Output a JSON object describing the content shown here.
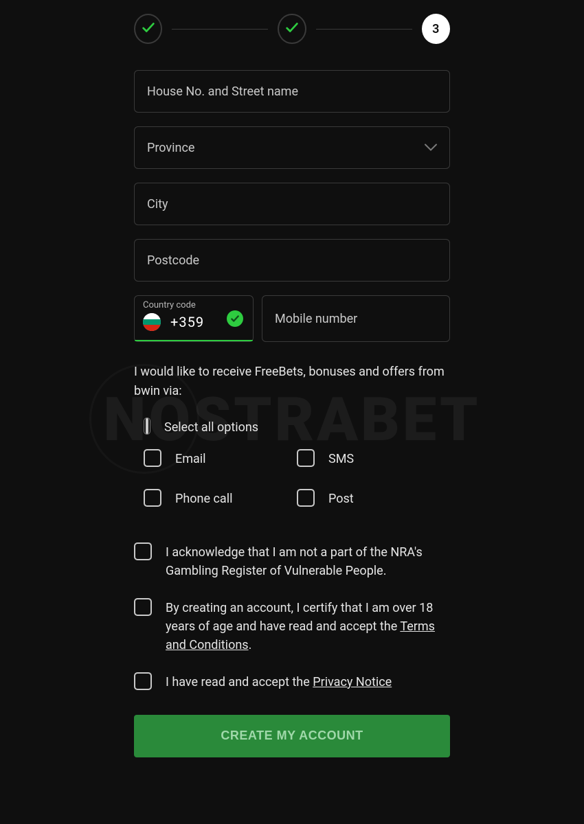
{
  "stepper": {
    "step1_state": "done",
    "step2_state": "done",
    "step3_label": "3"
  },
  "fields": {
    "street_placeholder": "House No. and Street name",
    "province_placeholder": "Province",
    "city_placeholder": "City",
    "postcode_placeholder": "Postcode",
    "country_code_label": "Country code",
    "country_code_value": "+359",
    "mobile_placeholder": "Mobile number"
  },
  "marketing": {
    "intro": "I would like to receive FreeBets, bonuses and offers from bwin via:",
    "select_all": "Select all options",
    "options": {
      "email": "Email",
      "sms": "SMS",
      "phone": "Phone call",
      "post": "Post"
    }
  },
  "consents": {
    "nra": "I acknowledge that I am not a part of the NRA's Gambling Register of Vulnerable People.",
    "terms_pre": "By creating an account, I certify that I am over 18 years of age and have read and accept the ",
    "terms_link": "Terms and Conditions",
    "terms_post": ".",
    "privacy_pre": "I have read and accept the ",
    "privacy_link": "Privacy Notice"
  },
  "submit_label": "CREATE MY ACCOUNT",
  "watermark_text": "NOSTRABET"
}
